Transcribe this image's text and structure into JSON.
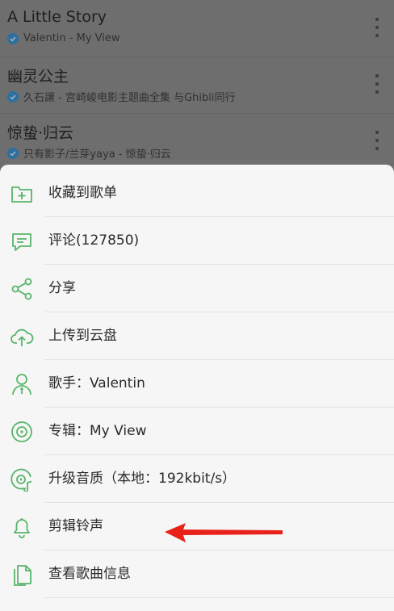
{
  "songs": [
    {
      "title": "A Little Story",
      "subtitle": "Valentin - My View"
    },
    {
      "title": "幽灵公主",
      "subtitle": "久石譲 - 宫崎峻电影主题曲全集   与Ghibli同行"
    },
    {
      "title": "惊蛰·归云",
      "subtitle": "只有影子/兰芽yaya - 惊蛰·归云"
    }
  ],
  "menu": {
    "items": [
      {
        "label": "收藏到歌单",
        "icon": "add-to-playlist-icon"
      },
      {
        "label": "评论(127850)",
        "icon": "comment-icon"
      },
      {
        "label": "分享",
        "icon": "share-icon"
      },
      {
        "label": "上传到云盘",
        "icon": "cloud-upload-icon"
      },
      {
        "label": "歌手：Valentin",
        "icon": "singer-icon"
      },
      {
        "label": "专辑：My View",
        "icon": "album-icon"
      },
      {
        "label": "升级音质（本地：192kbit/s）",
        "icon": "quality-icon"
      },
      {
        "label": "剪辑铃声",
        "icon": "bell-icon"
      },
      {
        "label": "查看歌曲信息",
        "icon": "song-info-icon"
      }
    ]
  },
  "colors": {
    "accent": "#57b56b",
    "annotation_arrow": "#e8211b",
    "overlay": "#6e6e6e"
  }
}
